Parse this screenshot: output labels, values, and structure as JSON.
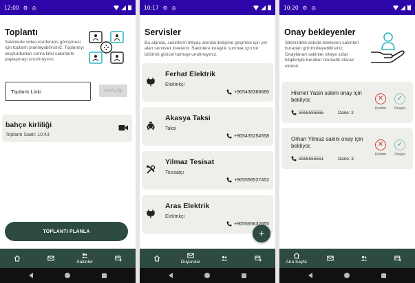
{
  "screen1": {
    "status": {
      "time": "12:00"
    },
    "title": "Toplantı",
    "description": "Sakinlerle video-konferans görüşmesi için toplantı planlayabilirsiniz. Toplantıyı oluşturduktan sonra linki sakinlerle paylaşmayı unutmayınız.",
    "link_input": {
      "value": "Toplantı Linki"
    },
    "share_label": "PAYLAŞ",
    "meeting": {
      "title": "bahçe kirliliği",
      "time": "Toplantı Saati: 10:43"
    },
    "plan_button": "TOPLANTI PLANLA",
    "nav": {
      "active_label": "Sakinler"
    }
  },
  "screen2": {
    "status": {
      "time": "10:17"
    },
    "title": "Servisler",
    "description": "Bu alanda, sakinlerin ihtiyaç anında iletişime geçmesi için yer alan servisler listelenir. Sakinlere kolaylık sunmak için bu bölümü güncel tutmayı unutmayınız.",
    "services": [
      {
        "name": "Ferhat Elektrik",
        "category": "Elektrikçi",
        "phone": "+905436366666",
        "icon": "plug-icon"
      },
      {
        "name": "Akasya Taksi",
        "category": "Taksi",
        "phone": "+905435254558",
        "icon": "taxi-icon"
      },
      {
        "name": "Yilmaz Tesisat",
        "category": "Tesisatçı",
        "phone": "+905556527452",
        "icon": "wrench-icon"
      },
      {
        "name": "Aras Elektrik",
        "category": "Elektrikçi",
        "phone": "+905565632655",
        "icon": "plug-icon"
      }
    ],
    "fab_label": "+",
    "nav": {
      "active_label": "Duyurular"
    }
  },
  "screen3": {
    "status": {
      "time": "10:20"
    },
    "title": "Onay bekleyenler",
    "description": "Sitenizdeki askıda bekleyen sakinleri buradan görüntüleyebilirsiniz. Onaylanan sakinler siteye sidat bilgileriyle beraber otomatik olarak eklenir.",
    "requests": [
      {
        "text": "Hikmet Yasin sakini onay için bekliyor.",
        "phone": "5555555555",
        "unit": "Daire: 2"
      },
      {
        "text": "Orhan Yilmaz sakini onay için bekliyor.",
        "phone": "5555555551",
        "unit": "Daire: 3"
      }
    ],
    "reject_label": "Reddet",
    "approve_label": "Onayla",
    "nav": {
      "active_label": "Ana Sayfa"
    }
  },
  "colors": {
    "status_bar": "#2c06a8",
    "primary": "#2d4a43",
    "card": "#eeeeea",
    "reject": "#d23b3b",
    "approve": "#8fbfb5"
  }
}
